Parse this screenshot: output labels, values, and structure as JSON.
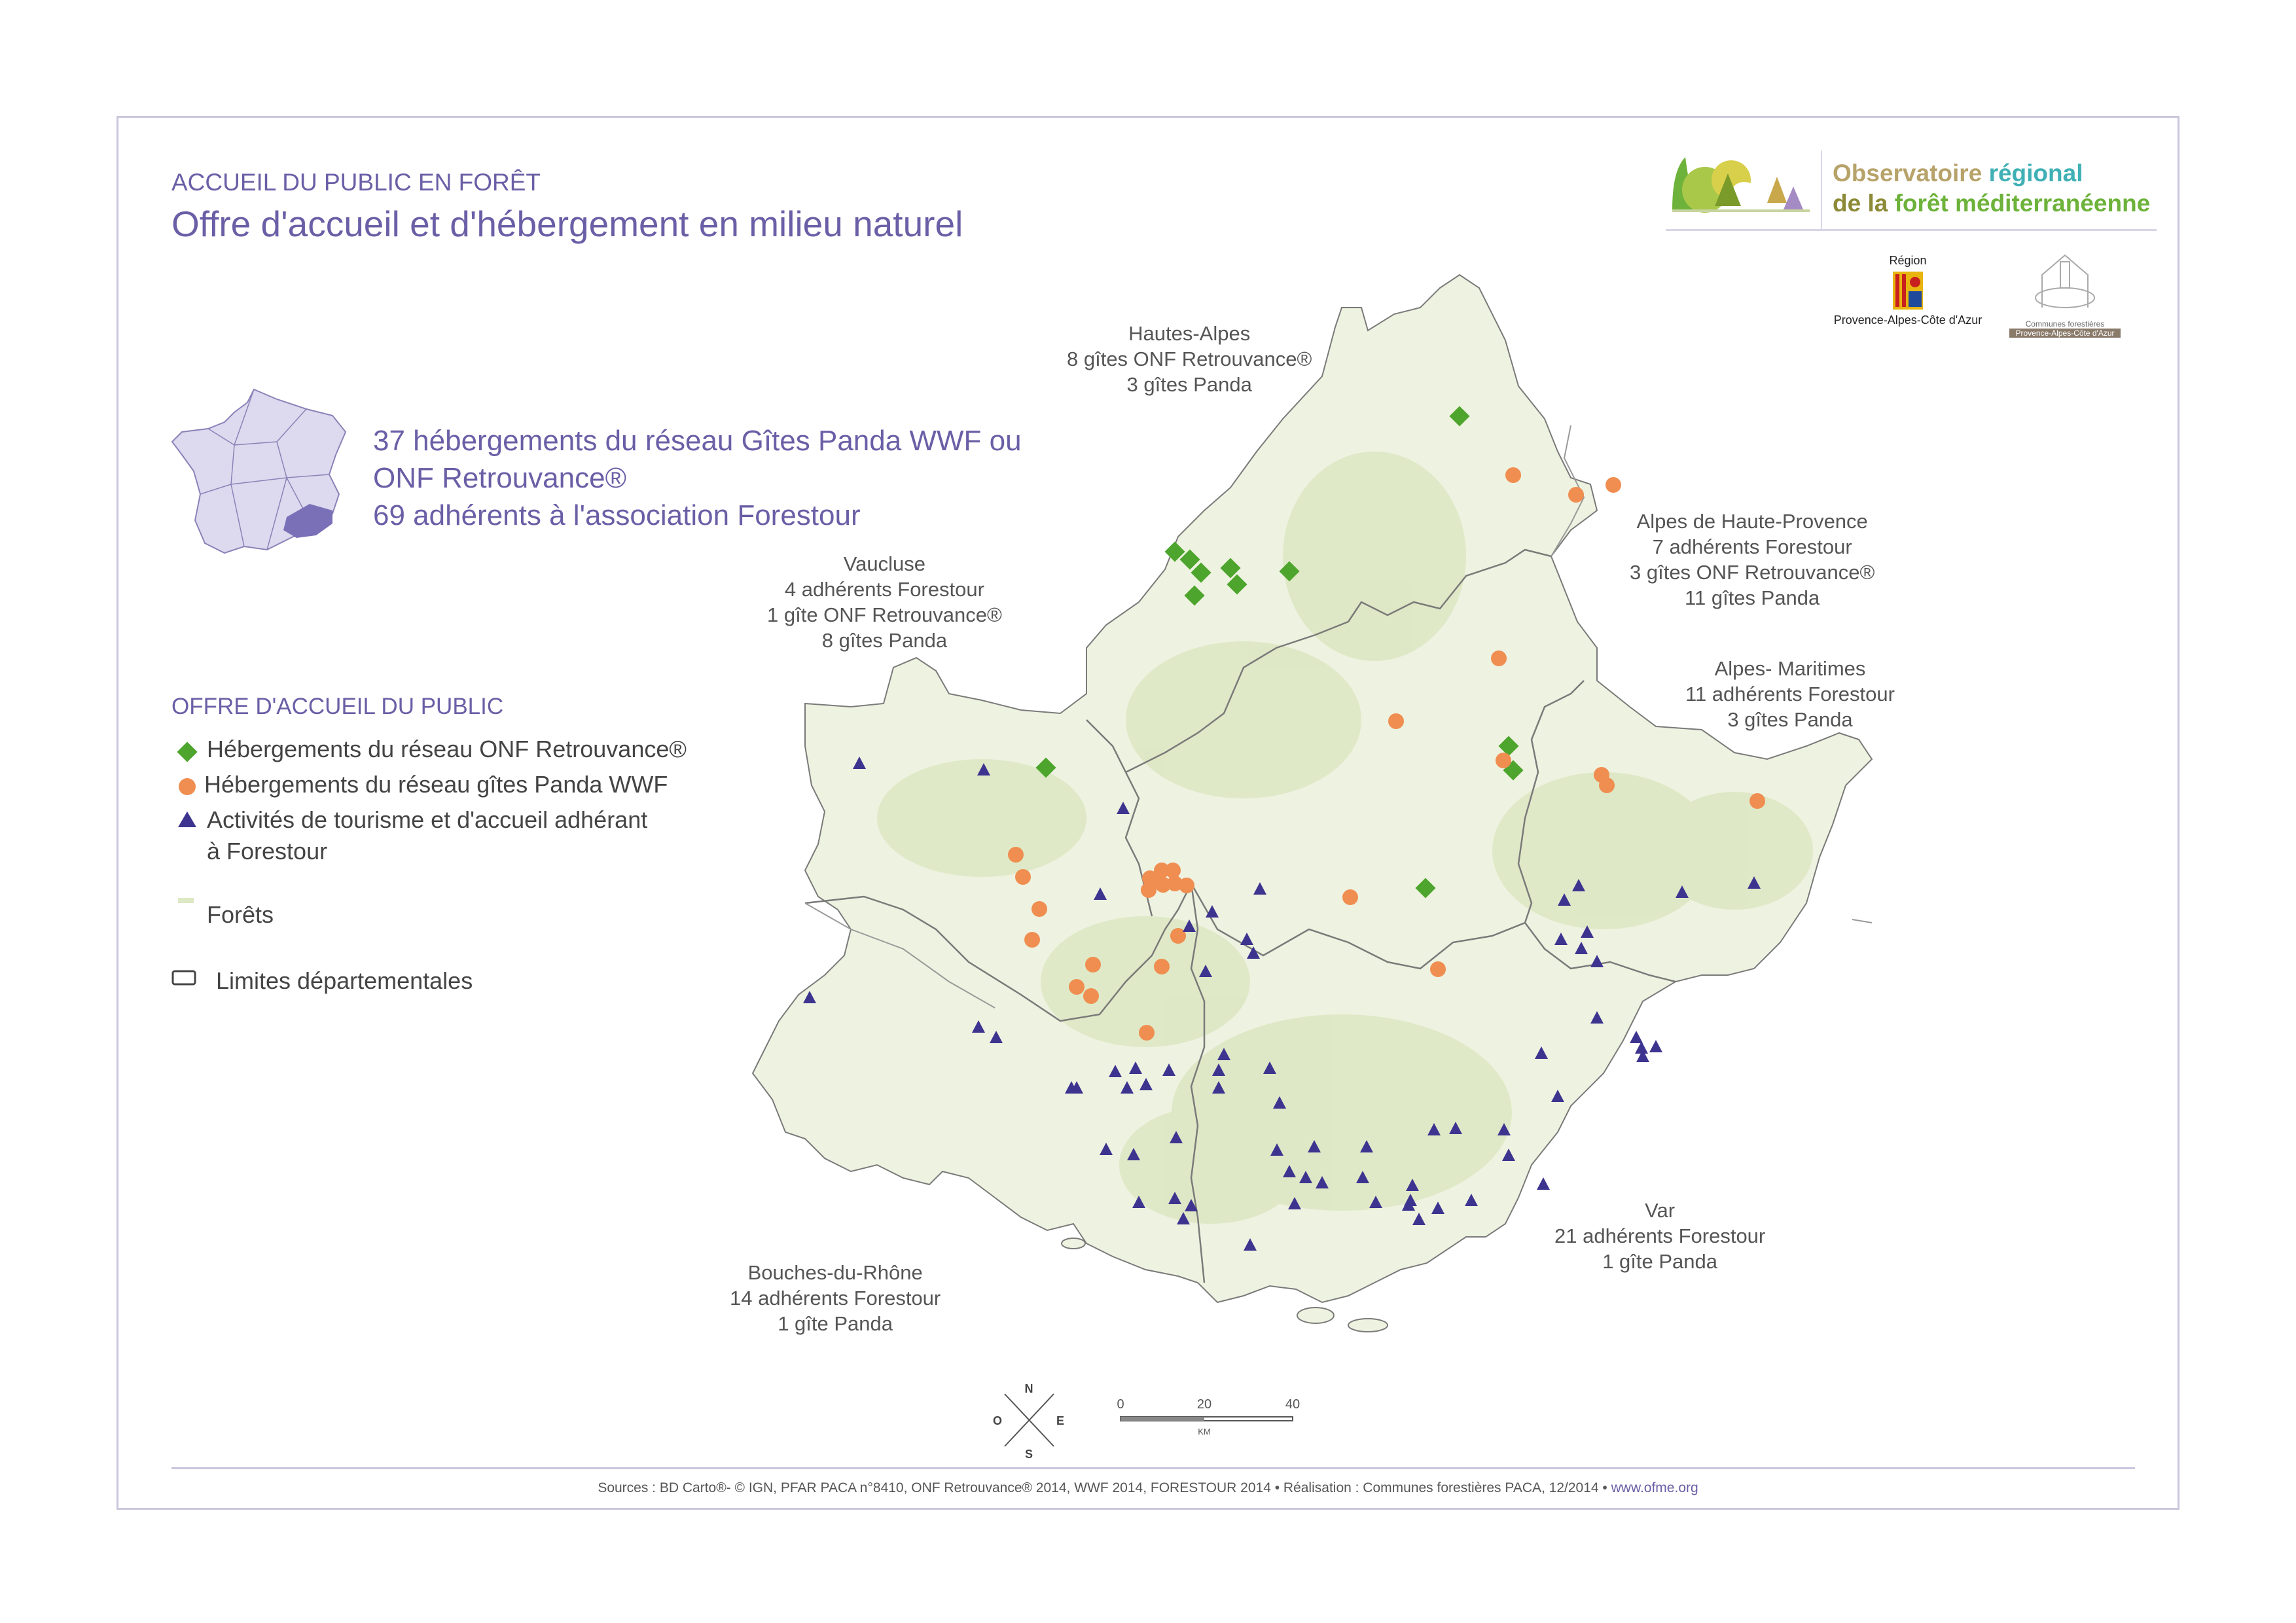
{
  "header": {
    "kicker": "ACCUEIL DU PUBLIC EN FORÊT",
    "title": "Offre d'accueil et d'hébergement en milieu naturel"
  },
  "logos": {
    "ofme_line1_a": "Observatoire",
    "ofme_line1_b": "régional",
    "ofme_line2_a": "de la",
    "ofme_line2_b": "forêt méditerranéenne",
    "region_top": "Région",
    "region_bottom": "Provence-Alpes-Côte d'Azur",
    "cf_line1": "Communes forestières",
    "cf_line2": "Provence-Alpes-Côte d'Azur"
  },
  "summary": {
    "line1": "37 hébergements du réseau Gîtes Panda WWF ou",
    "line2": "ONF Retrouvance®",
    "line3": "69 adhérents à l'association Forestour"
  },
  "legend": {
    "title": "OFFRE D'ACCUEIL DU PUBLIC",
    "onf": "Hébergements du réseau ONF Retrouvance®",
    "panda": "Hébergements du réseau gîtes Panda WWF",
    "forestour_1": "Activités de tourisme et d'accueil adhérant",
    "forestour_2": "à Forestour",
    "forets": "Forêts",
    "limites": "Limites départementales"
  },
  "departments": {
    "hautes_alpes": {
      "name": "Hautes-Alpes",
      "l1": "8 gîtes ONF Retrouvance®",
      "l2": "3 gîtes Panda"
    },
    "alpes_hp": {
      "name": "Alpes de Haute-Provence",
      "l1": "7 adhérents Forestour",
      "l2": "3 gîtes ONF Retrouvance®",
      "l3": "11 gîtes Panda"
    },
    "vaucluse": {
      "name": "Vaucluse",
      "l1": "4 adhérents Forestour",
      "l2": "1 gîte ONF Retrouvance®",
      "l3": "8 gîtes Panda"
    },
    "alpes_m": {
      "name": "Alpes-  Maritimes",
      "l1": "11 adhérents Forestour",
      "l2": "3 gîtes Panda"
    },
    "var": {
      "name": "Var",
      "l1": "21 adhérents Forestour",
      "l2": "1 gîte Panda"
    },
    "bdr": {
      "name": "Bouches-du-Rhône",
      "l1": "14 adhérents Forestour",
      "l2": "1 gîte Panda"
    }
  },
  "compass": {
    "n": "N",
    "s": "S",
    "e": "E",
    "o": "O"
  },
  "scale": {
    "t0": "0",
    "t1": "20",
    "t2": "40",
    "unit": "KM"
  },
  "sources": {
    "text": "Sources : BD Carto®- © IGN, PFAR PACA n°8410, ONF Retrouvance® 2014, WWF 2014, FORESTOUR 2014 • Réalisation : Communes forestières PACA, 12/2014 • ",
    "link": "www.ofme.org"
  },
  "colors": {
    "accent": "#6a5fa6",
    "land": "#eef2e0",
    "forest": "#dde8c4",
    "onf": "#4ea52d",
    "panda": "#ef8e50",
    "forestour": "#3d3490"
  }
}
